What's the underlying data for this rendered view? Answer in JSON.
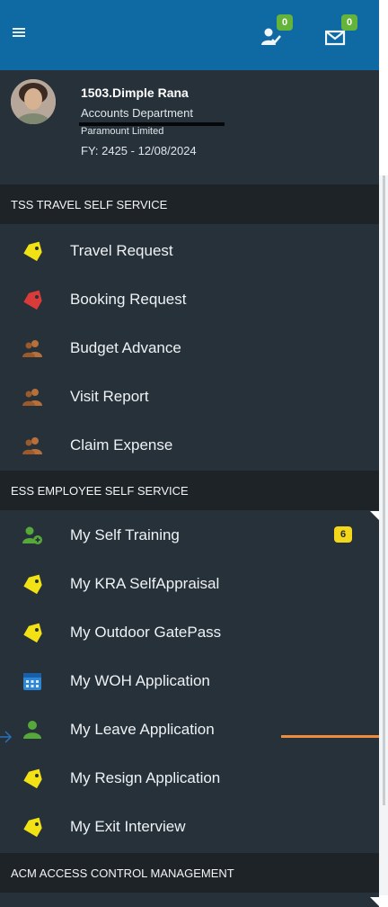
{
  "header": {
    "notification_count": "0",
    "message_count": "0",
    "menu_icon": "hamburger-icon",
    "notification_icon": "user-check-icon",
    "message_icon": "envelope-icon",
    "colors": {
      "bar": "#0f6aa4",
      "badge": "#64b33a"
    }
  },
  "profile": {
    "name": "1503.Dimple Rana",
    "department": "Accounts Department",
    "company": "Paramount Limited",
    "fy": "FY: 2425 - 12/08/2024"
  },
  "sections": [
    {
      "title": "TSS TRAVEL SELF SERVICE",
      "items": [
        {
          "label": "Travel Request",
          "icon": "tag-icon-yellow"
        },
        {
          "label": "Booking Request",
          "icon": "tag-icon-red"
        },
        {
          "label": "Budget Advance",
          "icon": "users-icon"
        },
        {
          "label": "Visit Report",
          "icon": "users-icon"
        },
        {
          "label": "Claim Expense",
          "icon": "users-icon"
        }
      ]
    },
    {
      "title": "ESS EMPLOYEE SELF SERVICE",
      "items": [
        {
          "label": "My Self Training",
          "icon": "user-add-icon",
          "badge": "6"
        },
        {
          "label": "My KRA SelfAppraisal",
          "icon": "tag-icon-yellow"
        },
        {
          "label": "My Outdoor GatePass",
          "icon": "tag-icon-yellow"
        },
        {
          "label": "My WOH Application",
          "icon": "calendar-icon"
        },
        {
          "label": "My Leave Application",
          "icon": "user-icon"
        },
        {
          "label": "My Resign Application",
          "icon": "tag-icon-yellow"
        },
        {
          "label": "My Exit Interview",
          "icon": "tag-icon-yellow"
        }
      ]
    },
    {
      "title": "ACM ACCESS CONTROL MANAGEMENT",
      "items": []
    }
  ],
  "colors": {
    "sidebar_bg": "#26313a",
    "section_header_bg": "#1e2328",
    "tag_yellow": "#f2e215",
    "tag_red": "#d93a3a",
    "users_brown": "#b7703b",
    "badge_yellow": "#f2d71a",
    "annotation_orange": "#ee8c3d"
  }
}
